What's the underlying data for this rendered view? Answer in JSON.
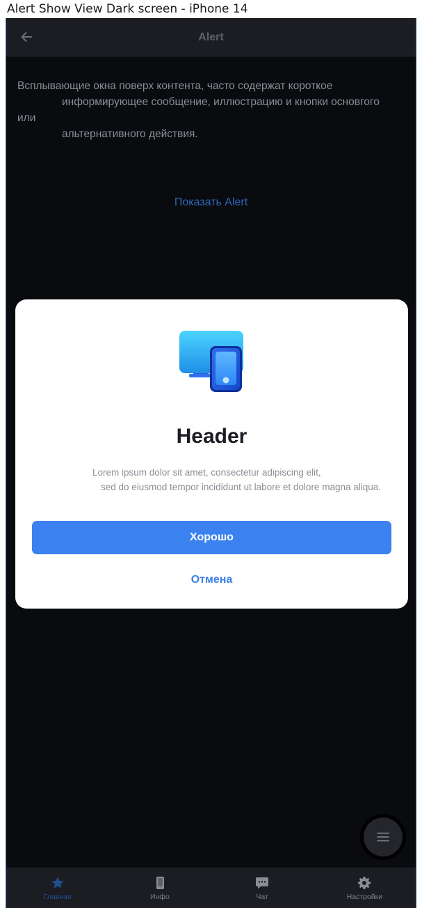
{
  "window": {
    "title": "Alert Show View Dark screen - iPhone 14"
  },
  "app_bar": {
    "title": "Alert",
    "back_icon": "arrow-left-icon"
  },
  "content": {
    "description_line1": "Всплывающие окна поверх контента, часто содержат короткое",
    "description_line2": "информирующее сообщение, иллюстрацию и кнопки основгого",
    "description_line3": "или",
    "description_line4": "альтернативного действия.",
    "show_alert_link": "Показать Alert"
  },
  "alert": {
    "illustration": "devices-icon",
    "header": "Header",
    "text_line1": "Lorem ipsum dolor sit amet, consectetur adipiscing elit,",
    "text_line2": "sed do eiusmod tempor incididunt ut labore et dolore magna aliqua.",
    "primary_button": "Хорошо",
    "secondary_button": "Отмена"
  },
  "fab": {
    "icon": "menu-icon"
  },
  "tabbar": {
    "items": [
      {
        "label": "Главная",
        "icon": "star-icon",
        "active": true
      },
      {
        "label": "Инфо",
        "icon": "phone-icon",
        "active": false
      },
      {
        "label": "Чат",
        "icon": "chat-icon",
        "active": false
      },
      {
        "label": "Настройки",
        "icon": "gear-icon",
        "active": false
      }
    ]
  },
  "colors": {
    "background": "#090b0f",
    "accent": "#3b82f0",
    "active_tab": "#1f4e91"
  }
}
